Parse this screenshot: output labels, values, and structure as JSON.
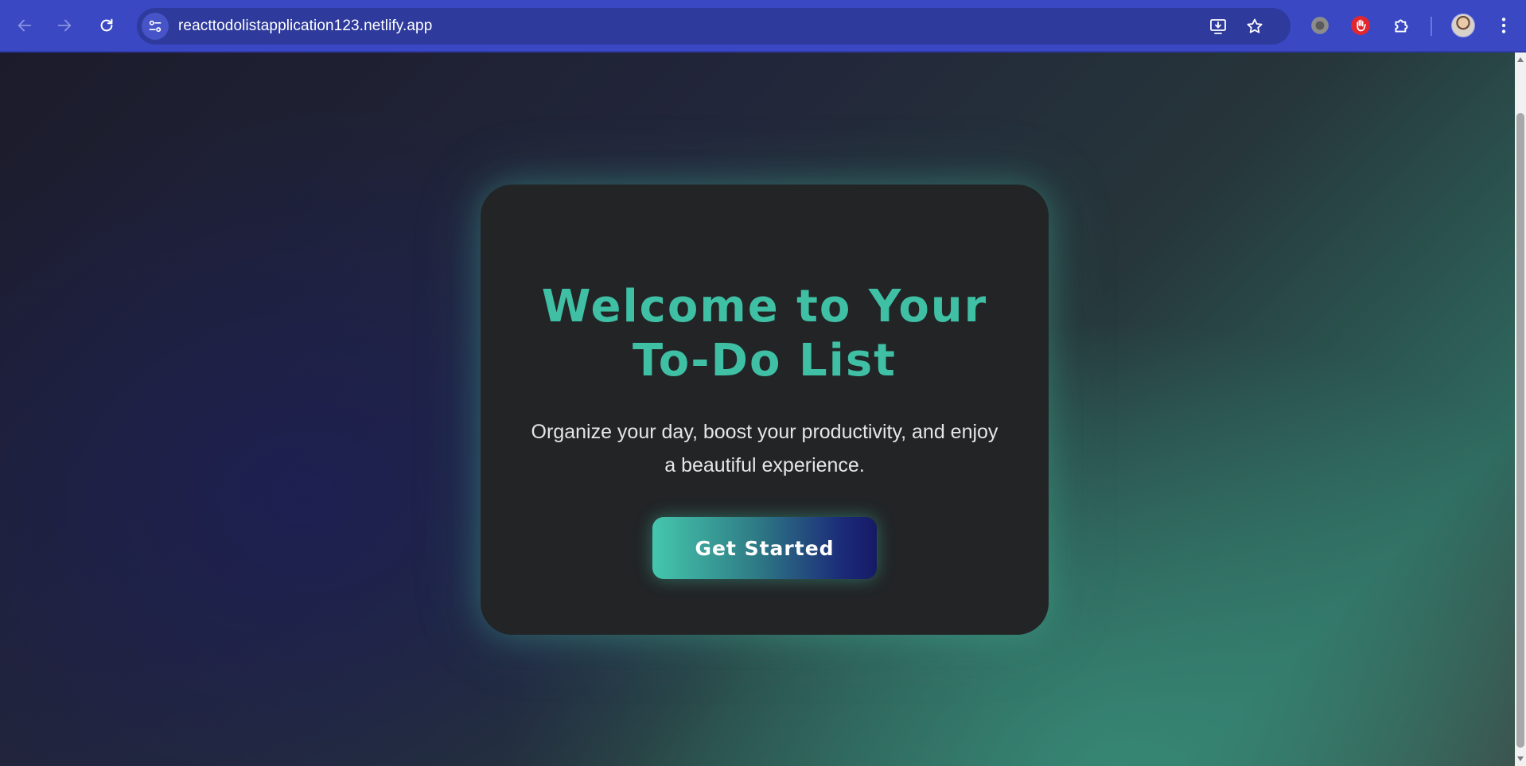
{
  "browser": {
    "url": "reacttodolistapplication123.netlify.app",
    "icons": {
      "back": "arrow-left-icon",
      "forward": "arrow-right-icon",
      "reload": "reload-icon",
      "site_info": "tune-icon",
      "install": "install-app-icon",
      "bookmark": "star-icon",
      "extension_1": "circle-extension-icon",
      "extension_2": "red-hand-extension-icon",
      "extensions_menu": "puzzle-icon",
      "menu": "kebab-menu-icon"
    },
    "colors": {
      "toolbar": "#3a48c4",
      "omnibox": "#2e3a9c"
    }
  },
  "page": {
    "title_line1": "Welcome to Your",
    "title_line2": "To-Do List",
    "description": "Organize your day, boost your productivity, and enjoy a beautiful experience.",
    "cta_label": "Get Started",
    "colors": {
      "accent": "#3fbfa4",
      "card_background": "#222426",
      "button_gradient_start": "#45c7ad",
      "button_gradient_end": "#161a66"
    }
  }
}
